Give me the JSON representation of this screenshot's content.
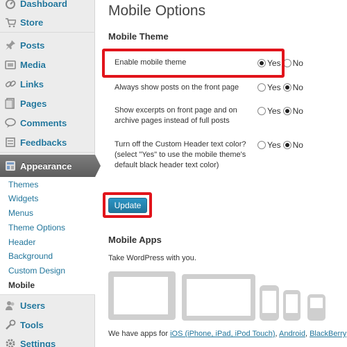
{
  "sidebar": {
    "items": [
      {
        "label": "Dashboard",
        "icon": "dashboard-icon"
      },
      {
        "label": "Store",
        "icon": "cart-icon"
      },
      {
        "label": "Posts",
        "icon": "pin-icon"
      },
      {
        "label": "Media",
        "icon": "media-icon"
      },
      {
        "label": "Links",
        "icon": "link-icon"
      },
      {
        "label": "Pages",
        "icon": "pages-icon"
      },
      {
        "label": "Comments",
        "icon": "comment-icon"
      },
      {
        "label": "Feedbacks",
        "icon": "feedback-icon"
      }
    ],
    "appearance": {
      "label": "Appearance",
      "icon": "appearance-icon"
    },
    "submenu": [
      "Themes",
      "Widgets",
      "Menus",
      "Theme Options",
      "Header",
      "Background",
      "Custom Design",
      "Mobile"
    ],
    "bottom_items": [
      {
        "label": "Users",
        "icon": "users-icon"
      },
      {
        "label": "Tools",
        "icon": "tools-icon"
      },
      {
        "label": "Settings",
        "icon": "settings-icon"
      }
    ]
  },
  "main": {
    "title": "Mobile Options",
    "theme_section": "Mobile Theme",
    "options": [
      {
        "label": "Enable mobile theme",
        "selected": "yes"
      },
      {
        "label": "Always show posts on the front page",
        "selected": "no"
      },
      {
        "label": "Show excerpts on front page and on archive pages instead of full posts",
        "selected": "no"
      },
      {
        "label": "Turn off the Custom Header text color? (select \"Yes\" to use the mobile theme's default black header text color)",
        "selected": "no"
      }
    ],
    "yes_label": "Yes",
    "no_label": "No",
    "update_label": "Update",
    "apps_section": "Mobile Apps",
    "apps_desc": "Take WordPress with you.",
    "apps_footer_prefix": "We have apps for ",
    "apps_links": [
      "iOS (iPhone, iPad, iPod Touch)",
      "Android",
      "BlackBerry"
    ],
    "apps_sep": ", "
  },
  "colors": {
    "highlight": "#e1141b",
    "link": "#21759b",
    "button": "#21759b"
  }
}
